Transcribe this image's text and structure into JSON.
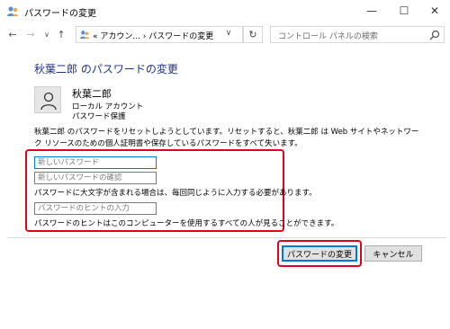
{
  "window": {
    "title": "パスワードの変更",
    "minimize_glyph": "—",
    "maximize_glyph": "☐",
    "close_glyph": "✕"
  },
  "nav": {
    "back_glyph": "←",
    "forward_glyph": "→",
    "dropdown_glyph": "∨",
    "up_glyph": "↑",
    "breadcrumb": "«  アカウン...  ›  パスワードの変更",
    "address_dropdown_glyph": "∨",
    "refresh_glyph": "↻",
    "search_placeholder": "コントロール パネルの検索"
  },
  "page": {
    "heading": "秋葉二郎 のパスワードの変更",
    "user": {
      "name": "秋葉二郎",
      "account_type": "ローカル アカウント",
      "protection": "パスワード保護"
    },
    "description": "秋葉二郎 のパスワードをリセットしようとしています。リセットすると、秋葉二郎 は Web サイトやネットワーク リソースのための個人証明書や保存しているパスワードをすべて失います。",
    "form": {
      "new_password_placeholder": "新しいパスワード",
      "confirm_password_placeholder": "新しいパスワードの確認",
      "case_note": "パスワードに大文字が含まれる場合は、毎回同じように入力する必要があります。",
      "hint_placeholder": "パスワードのヒントの入力",
      "hint_note": "パスワードのヒントはこのコンピューターを使用するすべての人が見ることができます。"
    },
    "buttons": {
      "change_password": "パスワードの変更",
      "cancel": "キャンセル"
    }
  },
  "colors": {
    "heading": "#1e3287",
    "highlight": "#e1001e",
    "focus": "#0078d7"
  }
}
